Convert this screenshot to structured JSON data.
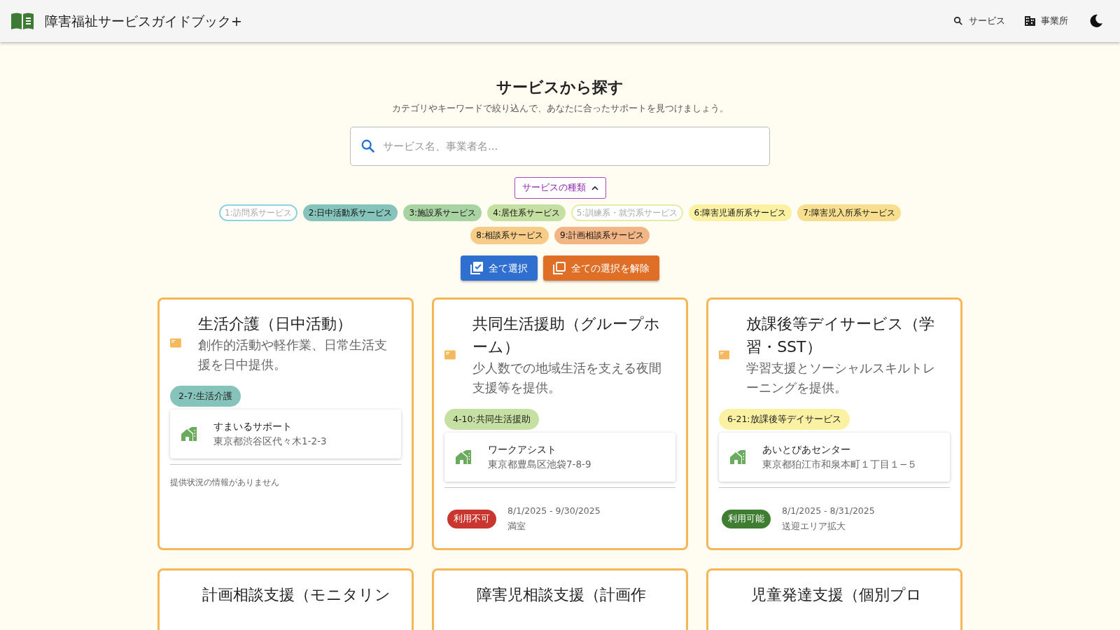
{
  "app_bar": {
    "title": "障害福祉サービスガイドブック+",
    "nav": [
      {
        "kind": "search",
        "label": "サービス"
      },
      {
        "kind": "building",
        "label": "事業所"
      }
    ]
  },
  "page": {
    "heading": "サービスから探す",
    "subtitle": "カテゴリやキーワードで絞り込んで、あなたに合ったサポートを見つけましょう。",
    "search": {
      "placeholder": "サービス名、事業者名..."
    }
  },
  "filter": {
    "label": "サービスの種類",
    "expanded": true,
    "categories": [
      {
        "label": "1:訪問系サービス",
        "selected": false,
        "color": "#8fd3e0"
      },
      {
        "label": "2:日中活動系サービス",
        "selected": true,
        "color": "#86c4bb"
      },
      {
        "label": "3:施設系サービス",
        "selected": true,
        "color": "#a9d3a3"
      },
      {
        "label": "4:居住系サービス",
        "selected": true,
        "color": "#c5e0a2"
      },
      {
        "label": "5:訓練系・就労系サービス",
        "selected": false,
        "color": "#e3eda9"
      },
      {
        "label": "6:障害児通所系サービス",
        "selected": true,
        "color": "#fbf1a3"
      },
      {
        "label": "7:障害児入所系サービス",
        "selected": true,
        "color": "#f8df8f"
      },
      {
        "label": "8:相談系サービス",
        "selected": true,
        "color": "#f6cc88"
      },
      {
        "label": "9:計画相談系サービス",
        "selected": true,
        "color": "#f2b585"
      }
    ],
    "buttons": [
      {
        "kind": "select_all",
        "label": "全て選択"
      },
      {
        "kind": "clear_all",
        "label": "全ての選択を解除"
      }
    ]
  },
  "services": [
    {
      "title": "生活介護（日中活動）",
      "description": "創作的活動や軽作業、日常生活支援を日中提供。",
      "tag": {
        "label": "2-7:生活介護",
        "color": "#86c4bb"
      },
      "office": {
        "name": "すまいるサポート",
        "address": "東京都渋谷区代々木1-2-3"
      },
      "availability": {
        "kind": "none",
        "message": "提供状況の情報がありません"
      }
    },
    {
      "title": "共同生活援助（グループホーム）",
      "description": "少人数での地域生活を支える夜間支援等を提供。",
      "tag": {
        "label": "4-10:共同生活援助",
        "color": "#c5e0a2"
      },
      "office": {
        "name": "ワークアシスト",
        "address": "東京都豊島区池袋7-8-9"
      },
      "availability": {
        "kind": "unavailable",
        "label": "利用不可",
        "period": "8/1/2025 - 9/30/2025",
        "note": "満室"
      }
    },
    {
      "title": "放課後等デイサービス（学習・SST）",
      "description": "学習支援とソーシャルスキルトレーニングを提供。",
      "tag": {
        "label": "6-21:放課後等デイサービス",
        "color": "#fbf1a3"
      },
      "office": {
        "name": "あいとぴあセンター",
        "address": "東京都狛江市和泉本町１丁目１−５"
      },
      "availability": {
        "kind": "available",
        "label": "利用可能",
        "period": "8/1/2025 - 8/31/2025",
        "note": "送迎エリア拡大"
      }
    },
    {
      "title": "計画相談支援（モニタリン"
    },
    {
      "title": "障害児相談支援（計画作"
    },
    {
      "title": "児童発達支援（個別プロ"
    }
  ]
}
